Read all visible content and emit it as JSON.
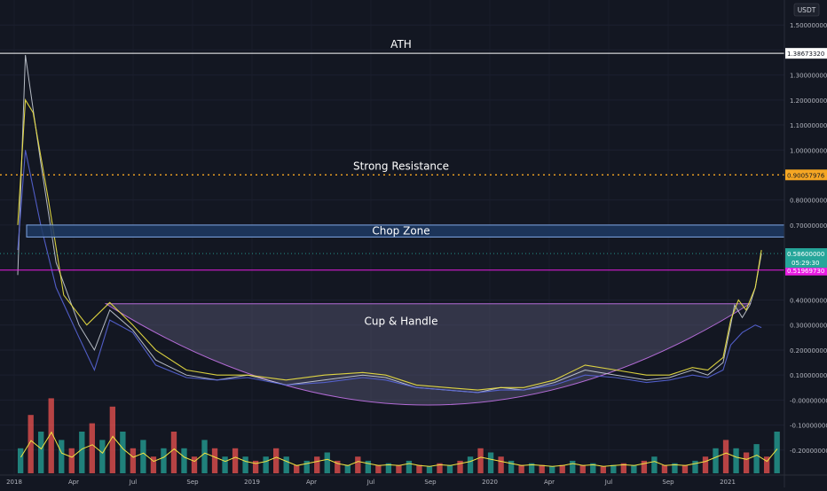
{
  "currency_badge": "USDT",
  "chart_data": {
    "type": "line",
    "x_ticks": [
      "2018",
      "Apr",
      "Jul",
      "Sep",
      "2019",
      "Apr",
      "Jul",
      "Sep",
      "2020",
      "Apr",
      "Jul",
      "Sep",
      "2021"
    ],
    "y_ticks": [
      "1.4",
      "1.50000000",
      "1.30000000",
      "1.20000000",
      "1.10000000",
      "1.00000000",
      "0.80000000",
      "0.70000000",
      "0.40000000",
      "0.30000000",
      "0.20000000",
      "0.10000000",
      "-0.00000000",
      "-0.10000000",
      "-0.20000000"
    ],
    "ylim": [
      -0.3,
      1.6
    ],
    "annotations": [
      {
        "label": "ATH",
        "price": 1.3867332,
        "price_label": "1.38673320",
        "style": "solid",
        "color": "#ffffff"
      },
      {
        "label": "Strong Resistance",
        "price": 0.90057976,
        "price_label": "0.90057976",
        "style": "dotted",
        "color": "#f5a623"
      },
      {
        "label": "Chop Zone",
        "range": [
          0.652,
          0.7
        ],
        "color": "#2962ff"
      },
      {
        "label": "",
        "price": 0.5196973,
        "price_label": "0.51969730",
        "style": "solid",
        "color": "#e91ee3"
      },
      {
        "label": "Cup & Handle",
        "type": "region",
        "color": "#5a5a78"
      }
    ],
    "last_price": {
      "value": 0.586,
      "label": "0.58600000",
      "countdown": "05:29:30",
      "color": "#26a69a"
    },
    "series": [
      {
        "style": "price",
        "color": "#c8cdd6",
        "x": [
          0,
          0.01,
          0.03,
          0.05,
          0.08,
          0.1,
          0.12,
          0.15,
          0.18,
          0.22,
          0.26,
          0.3,
          0.35,
          0.4,
          0.45,
          0.48,
          0.52,
          0.56,
          0.6,
          0.63,
          0.66,
          0.7,
          0.74,
          0.78,
          0.82,
          0.85,
          0.88,
          0.9,
          0.92,
          0.93,
          0.935,
          0.945,
          0.955,
          0.962,
          0.97
        ],
        "values": [
          0.5,
          1.38,
          0.95,
          0.55,
          0.3,
          0.2,
          0.36,
          0.28,
          0.16,
          0.1,
          0.08,
          0.1,
          0.06,
          0.08,
          0.1,
          0.09,
          0.05,
          0.04,
          0.03,
          0.05,
          0.04,
          0.07,
          0.12,
          0.1,
          0.08,
          0.09,
          0.12,
          0.1,
          0.15,
          0.3,
          0.38,
          0.33,
          0.38,
          0.45,
          0.586
        ]
      },
      {
        "style": "ma-fast",
        "color": "#f0e442",
        "x": [
          0,
          0.01,
          0.02,
          0.04,
          0.06,
          0.09,
          0.12,
          0.15,
          0.18,
          0.22,
          0.26,
          0.3,
          0.35,
          0.4,
          0.45,
          0.48,
          0.52,
          0.56,
          0.6,
          0.63,
          0.66,
          0.7,
          0.74,
          0.78,
          0.82,
          0.85,
          0.88,
          0.9,
          0.92,
          0.93,
          0.94,
          0.95,
          0.962,
          0.97
        ],
        "values": [
          0.7,
          1.2,
          1.15,
          0.8,
          0.42,
          0.3,
          0.39,
          0.3,
          0.2,
          0.12,
          0.1,
          0.1,
          0.08,
          0.1,
          0.11,
          0.1,
          0.06,
          0.05,
          0.04,
          0.05,
          0.05,
          0.08,
          0.14,
          0.12,
          0.1,
          0.1,
          0.13,
          0.12,
          0.17,
          0.32,
          0.4,
          0.36,
          0.45,
          0.6
        ]
      },
      {
        "style": "ma-slow",
        "color": "#5865d8",
        "x": [
          0,
          0.01,
          0.03,
          0.05,
          0.08,
          0.1,
          0.12,
          0.15,
          0.18,
          0.22,
          0.26,
          0.3,
          0.35,
          0.4,
          0.45,
          0.48,
          0.52,
          0.56,
          0.6,
          0.63,
          0.66,
          0.7,
          0.74,
          0.78,
          0.82,
          0.85,
          0.88,
          0.9,
          0.92,
          0.93,
          0.945,
          0.962,
          0.97
        ],
        "values": [
          0.6,
          1.0,
          0.7,
          0.45,
          0.25,
          0.12,
          0.32,
          0.27,
          0.14,
          0.09,
          0.08,
          0.09,
          0.06,
          0.07,
          0.09,
          0.08,
          0.05,
          0.04,
          0.03,
          0.04,
          0.04,
          0.06,
          0.1,
          0.09,
          0.07,
          0.08,
          0.1,
          0.09,
          0.12,
          0.22,
          0.27,
          0.3,
          0.29
        ]
      }
    ],
    "volume": {
      "colors": [
        "#26a69a",
        "#ef5350"
      ],
      "overlay_color": "#f0e442",
      "bars": [
        0.3,
        0.7,
        0.5,
        0.9,
        0.4,
        0.3,
        0.5,
        0.6,
        0.4,
        0.8,
        0.5,
        0.3,
        0.4,
        0.2,
        0.3,
        0.5,
        0.3,
        0.2,
        0.4,
        0.3,
        0.2,
        0.3,
        0.2,
        0.15,
        0.2,
        0.3,
        0.2,
        0.1,
        0.15,
        0.2,
        0.25,
        0.15,
        0.1,
        0.2,
        0.15,
        0.1,
        0.12,
        0.1,
        0.15,
        0.1,
        0.08,
        0.12,
        0.1,
        0.15,
        0.2,
        0.3,
        0.25,
        0.2,
        0.15,
        0.1,
        0.12,
        0.1,
        0.08,
        0.1,
        0.15,
        0.1,
        0.12,
        0.08,
        0.1,
        0.12,
        0.1,
        0.15,
        0.2,
        0.1,
        0.12,
        0.1,
        0.15,
        0.2,
        0.3,
        0.4,
        0.3,
        0.25,
        0.35,
        0.2,
        0.5
      ]
    }
  }
}
